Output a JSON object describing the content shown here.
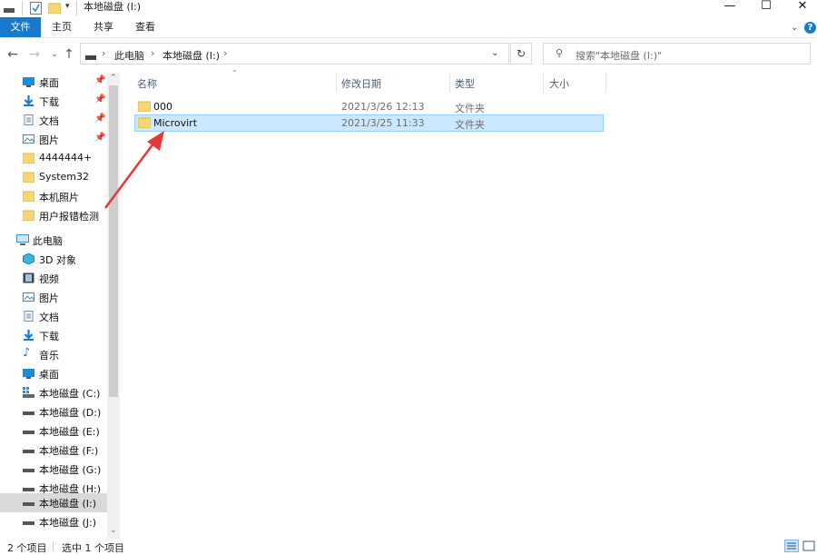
{
  "window": {
    "title": "本地磁盘 (I:)",
    "controls": {
      "minimize": "—",
      "maximize": "☐",
      "close": "✕"
    }
  },
  "ribbon": {
    "tabs": [
      "文件",
      "主页",
      "共享",
      "查看"
    ],
    "help": "?"
  },
  "address": {
    "crumbs": [
      "此电脑",
      "本地磁盘 (I:)"
    ],
    "search_placeholder": "搜索\"本地磁盘 (I:)\""
  },
  "sidebar": {
    "quick_access": [
      {
        "label": "桌面",
        "icon": "desktop-icon",
        "pinned": true
      },
      {
        "label": "下载",
        "icon": "download-icon",
        "pinned": true
      },
      {
        "label": "文档",
        "icon": "document-icon",
        "pinned": true
      },
      {
        "label": "图片",
        "icon": "picture-icon",
        "pinned": true
      },
      {
        "label": "4444444+",
        "icon": "folder-icon",
        "pinned": false
      },
      {
        "label": "System32",
        "icon": "folder-icon",
        "pinned": false
      },
      {
        "label": "本机照片",
        "icon": "folder-icon",
        "pinned": false
      },
      {
        "label": "用户报错检测",
        "icon": "folder-icon",
        "pinned": false
      }
    ],
    "this_pc": "此电脑",
    "this_pc_items": [
      {
        "label": "3D 对象",
        "icon": "3d-objects-icon"
      },
      {
        "label": "视频",
        "icon": "video-icon"
      },
      {
        "label": "图片",
        "icon": "picture-icon"
      },
      {
        "label": "文档",
        "icon": "document-icon"
      },
      {
        "label": "下载",
        "icon": "download-icon"
      },
      {
        "label": "音乐",
        "icon": "music-icon"
      },
      {
        "label": "桌面",
        "icon": "desktop-icon"
      },
      {
        "label": "本地磁盘 (C:)",
        "icon": "system-drive-icon"
      },
      {
        "label": "本地磁盘 (D:)",
        "icon": "drive-icon"
      },
      {
        "label": "本地磁盘 (E:)",
        "icon": "drive-icon"
      },
      {
        "label": "本地磁盘 (F:)",
        "icon": "drive-icon"
      },
      {
        "label": "本地磁盘 (G:)",
        "icon": "drive-icon"
      },
      {
        "label": "本地磁盘 (H:)",
        "icon": "drive-icon"
      },
      {
        "label": "本地磁盘 (I:)",
        "icon": "drive-icon",
        "selected": true
      },
      {
        "label": "本地磁盘 (J:)",
        "icon": "drive-icon"
      }
    ]
  },
  "file_list": {
    "columns": [
      "名称",
      "修改日期",
      "类型",
      "大小"
    ],
    "rows": [
      {
        "name": "000",
        "modified": "2021/3/26 12:13",
        "type": "文件夹",
        "size": ""
      },
      {
        "name": "Microvirt",
        "modified": "2021/3/25 11:33",
        "type": "文件夹",
        "size": "",
        "selected": true
      }
    ]
  },
  "status": {
    "count": "2 个项目",
    "selection": "选中 1 个项目"
  },
  "colors": {
    "accent": "#1979ca",
    "selection_bg": "#cce8ff",
    "selection_border": "#99d1ff",
    "annotation_arrow": "#e53935",
    "folder": "#f7d774"
  }
}
